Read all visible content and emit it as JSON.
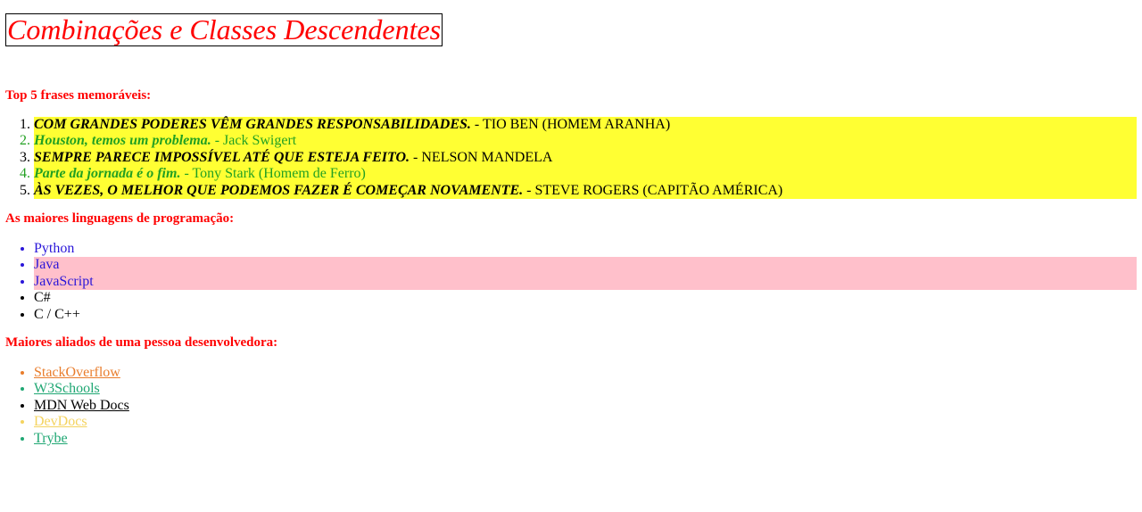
{
  "title": "Combinações e Classes Descendentes",
  "sections": {
    "quotes": {
      "heading": "Top 5 frases memoráveis:",
      "items": [
        {
          "quote": "COM GRANDES PODERES VÊM GRANDES RESPONSABILIDADES.",
          "author": " - TIO BEN (HOMEM ARANHA)"
        },
        {
          "quote": "Houston, temos um problema.",
          "author": " - Jack Swigert"
        },
        {
          "quote": "SEMPRE PARECE IMPOSSÍVEL ATÉ QUE ESTEJA FEITO.",
          "author": " - NELSON MANDELA"
        },
        {
          "quote": "Parte da jornada é o fim.",
          "author": " - Tony Stark (Homem de Ferro)"
        },
        {
          "quote": "ÀS VEZES, O MELHOR QUE PODEMOS FAZER É COMEÇAR NOVAMENTE.",
          "author": " - STEVE ROGERS (CAPITÃO AMÉRICA)"
        }
      ]
    },
    "languages": {
      "heading": "As maiores linguagens de programação:",
      "items": [
        "Python",
        "Java",
        "JavaScript",
        "C#",
        "C / C++"
      ]
    },
    "allies": {
      "heading": "Maiores aliados de uma pessoa desenvolvedora:",
      "items": [
        "StackOverflow",
        "W3Schools",
        "MDN Web Docs",
        "DevDocs",
        "Trybe"
      ]
    }
  },
  "colors": {
    "heading_red": "#ff0000",
    "quote_highlight": "#ffff33",
    "quote_green": "#22a022",
    "language_blue": "#2a16d9",
    "language_pink": "#ffc0cb",
    "ally_orange": "#e97d2c",
    "ally_teal": "#1fa773",
    "ally_gold": "#f4d35e"
  }
}
